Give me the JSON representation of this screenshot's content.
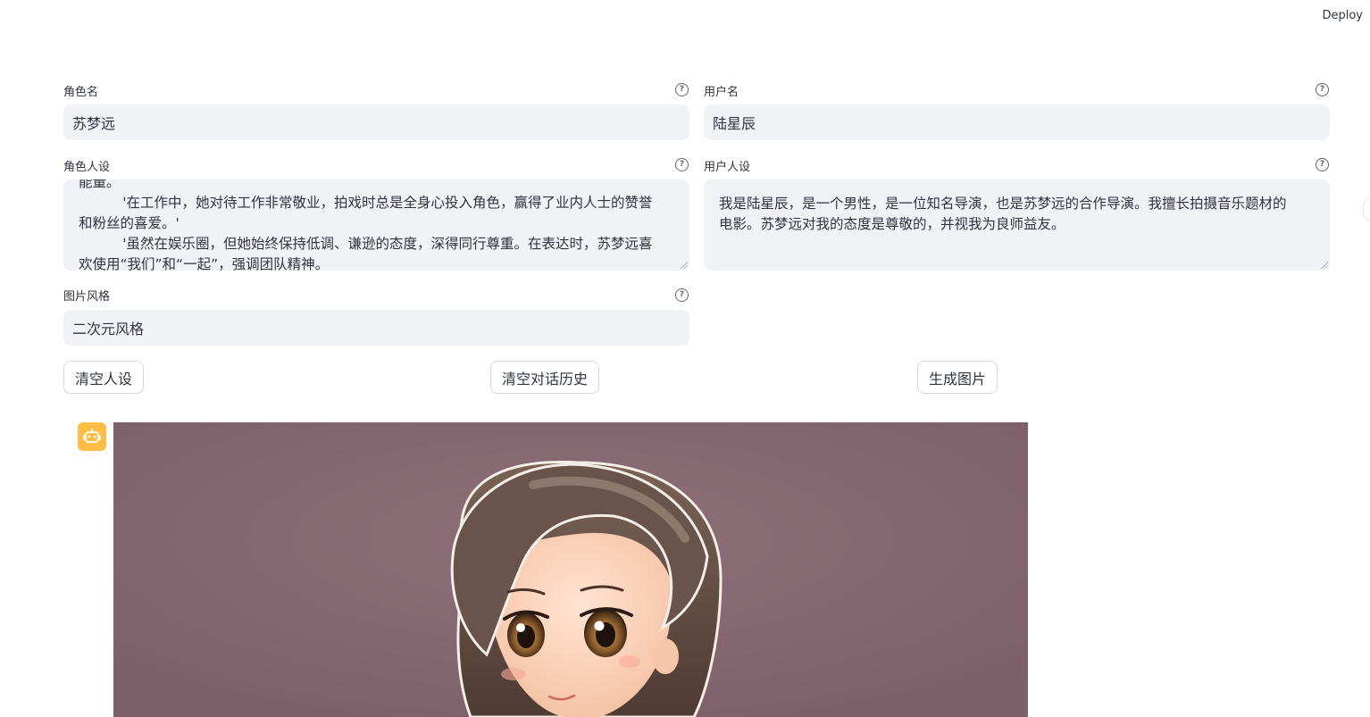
{
  "header": {
    "deploy_label": "Deploy"
  },
  "form": {
    "character_name": {
      "label": "角色名",
      "value": "苏梦远"
    },
    "user_name": {
      "label": "用户名",
      "value": "陆星辰"
    },
    "character_persona": {
      "label": "角色人设",
      "value": "能量。\n          '在工作中，她对待工作非常敬业，拍戏时总是全身心投入角色，赢得了业内人士的赞誉和粉丝的喜爱。'\n          '虽然在娱乐圈，但她始终保持低调、谦逊的态度，深得同行尊重。在表达时，苏梦远喜欢使用“我们”和“一起”，强调团队精神。"
    },
    "user_persona": {
      "label": "用户人设",
      "value": "我是陆星辰，是一个男性，是一位知名导演，也是苏梦远的合作导演。我擅长拍摄音乐题材的电影。苏梦远对我的态度是尊敬的，并视我为良师益友。"
    },
    "image_style": {
      "label": "图片风格",
      "value": "二次元风格"
    }
  },
  "buttons": {
    "clear_persona": "清空人设",
    "clear_history": "清空对话历史",
    "generate_image": "生成图片"
  },
  "chat": {
    "avatar_icon": "robot-icon",
    "avatar_color": "#ffbd45",
    "image_background": "#846772"
  }
}
